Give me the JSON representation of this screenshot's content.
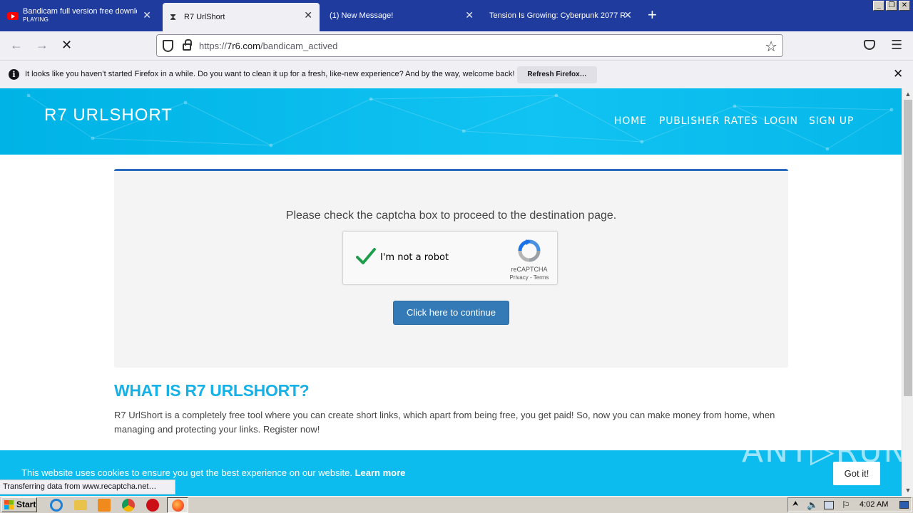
{
  "browser": {
    "tabs": [
      {
        "title": "Bandicam full version free download",
        "subtitle": "PLAYING",
        "icon": "youtube-icon"
      },
      {
        "title": "R7 UrlShort",
        "icon": "hourglass-icon",
        "active": true
      },
      {
        "title": "(1) New Message!"
      },
      {
        "title": "Tension Is Growing: Cyberpunk 2077 R..."
      }
    ],
    "url_prefix": "https://",
    "url_domain": "7r6.com",
    "url_path": "/bandicam_actived",
    "notification": "It looks like you haven’t started Firefox in a while. Do you want to clean it up for a fresh, like-new experience? And by the way, welcome back!",
    "refresh_label": "Refresh Firefox…",
    "status": "Transferring data from www.recaptcha.net…"
  },
  "site": {
    "logo": "R7 URLSHORT",
    "nav": {
      "home": "HOME",
      "rates": "PUBLISHER RATES",
      "login": "LOGIN",
      "signup": "SIGN UP"
    },
    "captcha_prompt": "Please check the captcha box to proceed to the destination page.",
    "recaptcha": {
      "label": "I'm not a robot",
      "brand": "reCAPTCHA",
      "links": "Privacy - Terms",
      "checked": true
    },
    "continue_label": "Click here to continue",
    "about_title": "WHAT IS R7 URLSHORT?",
    "about_text": "R7 UrlShort is a completely free tool where you can create short links, which apart from being free, you get paid! So, now you can make money from home, when managing and protecting your links. Register now!",
    "cookie_text": "This website uses cookies to ensure you get the best experience on our website.",
    "cookie_link": "Learn more",
    "cookie_button": "Got it!",
    "watermark": "ANY▷RUN"
  },
  "taskbar": {
    "start": "Start",
    "clock": "4:02 AM"
  },
  "colors": {
    "header": "#00b3e6",
    "accent_button": "#337ab7",
    "heading": "#16b1e6",
    "tab_strip": "#1f3b9e"
  }
}
